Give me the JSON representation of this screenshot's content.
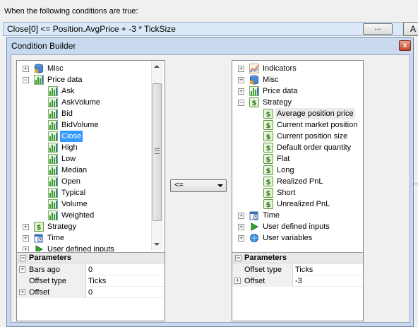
{
  "header": {
    "label": "When the following conditions are true:",
    "condition": "Close[0] <= Position.AvgPrice + -3 * TickSize",
    "ellipsis_button": "...",
    "add_button": "A"
  },
  "dialog": {
    "title": "Condition Builder",
    "close_glyph": "x",
    "operator": "<="
  },
  "left_tree": [
    {
      "label": "Misc",
      "icon": "database-icon",
      "level": 0,
      "expander": "+"
    },
    {
      "label": "Price data",
      "icon": "bar-chart-icon",
      "level": 0,
      "expander": "-"
    },
    {
      "label": "Ask",
      "icon": "bar-chart-icon",
      "level": 1
    },
    {
      "label": "AskVolume",
      "icon": "bar-chart-icon",
      "level": 1
    },
    {
      "label": "Bid",
      "icon": "bar-chart-icon",
      "level": 1
    },
    {
      "label": "BidVolume",
      "icon": "bar-chart-icon",
      "level": 1
    },
    {
      "label": "Close",
      "icon": "bar-chart-icon",
      "level": 1,
      "selected": true
    },
    {
      "label": "High",
      "icon": "bar-chart-icon",
      "level": 1
    },
    {
      "label": "Low",
      "icon": "bar-chart-icon",
      "level": 1
    },
    {
      "label": "Median",
      "icon": "bar-chart-icon",
      "level": 1
    },
    {
      "label": "Open",
      "icon": "bar-chart-icon",
      "level": 1
    },
    {
      "label": "Typical",
      "icon": "bar-chart-icon",
      "level": 1
    },
    {
      "label": "Volume",
      "icon": "bar-chart-icon",
      "level": 1
    },
    {
      "label": "Weighted",
      "icon": "bar-chart-icon",
      "level": 1
    },
    {
      "label": "Strategy",
      "icon": "dollar-icon",
      "level": 0,
      "expander": "+"
    },
    {
      "label": "Time",
      "icon": "calendar-icon",
      "level": 0,
      "expander": "+"
    },
    {
      "label": "User defined inputs",
      "icon": "play-icon",
      "level": 0,
      "expander": "+"
    }
  ],
  "right_tree": [
    {
      "label": "Indicators",
      "icon": "line-chart-icon",
      "level": 0,
      "expander": "+"
    },
    {
      "label": "Misc",
      "icon": "database-icon",
      "level": 0,
      "expander": "+"
    },
    {
      "label": "Price data",
      "icon": "bar-chart-icon",
      "level": 0,
      "expander": "+"
    },
    {
      "label": "Strategy",
      "icon": "dollar-icon",
      "level": 0,
      "expander": "-"
    },
    {
      "label": "Average position price",
      "icon": "dollar-icon",
      "level": 1,
      "hover": true
    },
    {
      "label": "Current market position",
      "icon": "dollar-icon",
      "level": 1
    },
    {
      "label": "Current position size",
      "icon": "dollar-icon",
      "level": 1
    },
    {
      "label": "Default order quantity",
      "icon": "dollar-icon",
      "level": 1
    },
    {
      "label": "Flat",
      "icon": "dollar-icon",
      "level": 1
    },
    {
      "label": "Long",
      "icon": "dollar-icon",
      "level": 1
    },
    {
      "label": "Realized PnL",
      "icon": "dollar-icon",
      "level": 1
    },
    {
      "label": "Short",
      "icon": "dollar-icon",
      "level": 1
    },
    {
      "label": "Unrealized PnL",
      "icon": "dollar-icon",
      "level": 1
    },
    {
      "label": "Time",
      "icon": "calendar-icon",
      "level": 0,
      "expander": "+"
    },
    {
      "label": "User defined inputs",
      "icon": "play-icon",
      "level": 0,
      "expander": "+"
    },
    {
      "label": "User variables",
      "icon": "globe-icon",
      "level": 0,
      "expander": "+"
    }
  ],
  "left_params": {
    "title": "Parameters",
    "header_expander": "-",
    "rows": [
      {
        "name": "Bars ago",
        "value": "0",
        "expander": "+"
      },
      {
        "name": "Offset type",
        "value": "Ticks"
      },
      {
        "name": "Offset",
        "value": "0",
        "expander": "+"
      }
    ]
  },
  "right_params": {
    "title": "Parameters",
    "header_expander": "-",
    "rows": [
      {
        "name": "Offset type",
        "value": "Ticks"
      },
      {
        "name": "Offset",
        "value": "-3",
        "expander": "+"
      }
    ]
  },
  "colors": {
    "selection": "#3399ff",
    "dialog_frame": "#c9daf0",
    "condition_bar": "#dbe8f7",
    "icon_green": "#3a9a2a",
    "icon_blue": "#3a72c4"
  }
}
